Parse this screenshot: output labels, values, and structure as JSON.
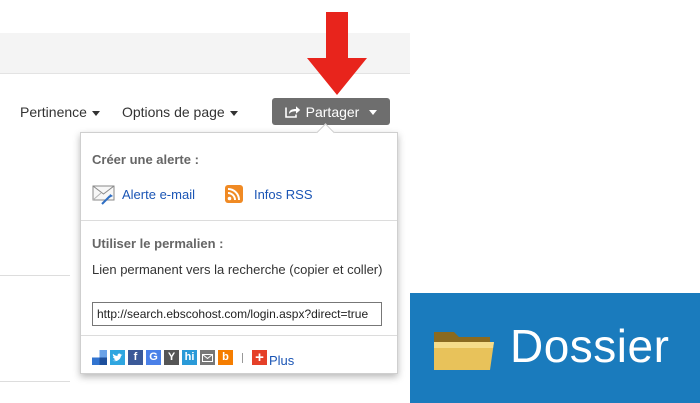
{
  "toolbar": {
    "relevance": "Pertinence",
    "page_options": "Options de page",
    "share": "Partager"
  },
  "share_menu": {
    "alert_title": "Créer une alerte :",
    "email_alert": "Alerte e-mail",
    "rss": "Infos RSS",
    "permalink_title": "Utiliser le permalien :",
    "permalink_desc": "Lien permanent vers la recherche (copier et coller)",
    "permalink_value": "http://search.ebscohost.com/login.aspx?direct=true",
    "social": [
      {
        "name": "delicious",
        "glyph": "",
        "color": "#3274d0"
      },
      {
        "name": "twitter",
        "glyph": "",
        "color": "#2fa6e0"
      },
      {
        "name": "facebook",
        "glyph": "f",
        "color": "#3b5998"
      },
      {
        "name": "google",
        "glyph": "G",
        "color": "#4a80e8"
      },
      {
        "name": "ycombinator",
        "glyph": "Y",
        "color": "#555555"
      },
      {
        "name": "hi5",
        "glyph": "hi",
        "color": "#2a9ad8"
      },
      {
        "name": "email",
        "glyph": "",
        "color": "#777777"
      },
      {
        "name": "blogger",
        "glyph": "b",
        "color": "#f57d00"
      }
    ],
    "plus": "Plus"
  },
  "folder": {
    "label": "Dossier"
  },
  "colors": {
    "accent_arrow": "#e8241c",
    "share_button": "#6e6e6e",
    "link": "#1a55b5",
    "folder_bg": "#1a7bbd"
  }
}
